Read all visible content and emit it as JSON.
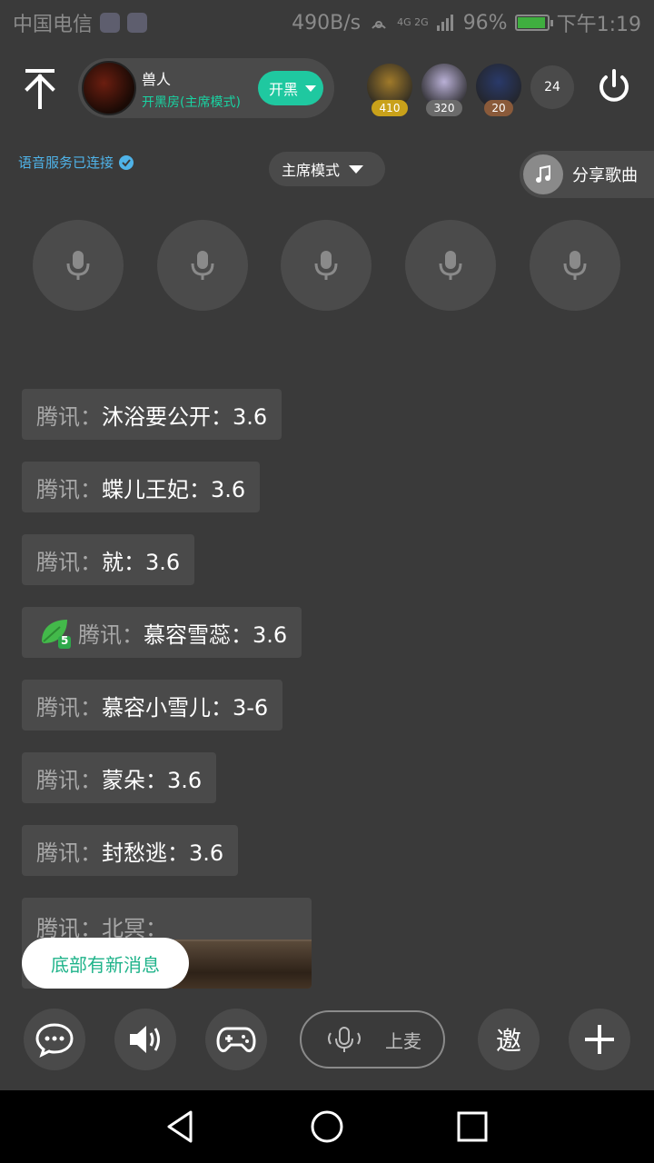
{
  "status_bar": {
    "carrier": "中国电信",
    "speed": "490B/s",
    "network": "4G 2G",
    "battery": "96%",
    "battery_level": 0.96,
    "time": "下午1:19"
  },
  "header": {
    "room": {
      "name": "兽人",
      "mode": "开黑房(主席模式)",
      "open_button": "开黑"
    },
    "viewers": [
      {
        "count": "410",
        "badge_color": "#c9a11a",
        "avatar_color": "#a07a2a"
      },
      {
        "count": "320",
        "badge_color": "#6b6b6b",
        "avatar_color": "#b9b0d6"
      },
      {
        "count": "20",
        "badge_color": "#8a5a3a",
        "avatar_color": "#2a3a6a"
      }
    ],
    "viewer_total": "24"
  },
  "voice": {
    "status": "语音服务已连接",
    "mode": "主席模式",
    "share_song": "分享歌曲"
  },
  "seats": 5,
  "messages": [
    {
      "sender": "腾讯：",
      "content": "沐浴要公开：3.6",
      "badge": false
    },
    {
      "sender": "腾讯：",
      "content": "蝶儿王妃：3.6",
      "badge": false
    },
    {
      "sender": "腾讯：",
      "content": "就：3.6",
      "badge": false
    },
    {
      "sender": "腾讯：",
      "content": "慕容雪蕊：3.6",
      "badge": true,
      "badge_level": "5"
    },
    {
      "sender": "腾讯：",
      "content": "慕容小雪儿：3-6",
      "badge": false
    },
    {
      "sender": "腾讯：",
      "content": "蒙朵：3.6",
      "badge": false
    },
    {
      "sender": "腾讯：",
      "content": "封愁逃：3.6",
      "badge": false
    }
  ],
  "image_message": {
    "sender": "腾讯：北冥："
  },
  "new_message_pill": "底部有新消息",
  "bottom_bar": {
    "mic_up_label": "上麦",
    "invite_label": "邀"
  },
  "colors": {
    "accent": "#1fc8a0",
    "background": "#3a3a3a",
    "panel": "#4a4a4a",
    "link": "#4fb3e8"
  }
}
